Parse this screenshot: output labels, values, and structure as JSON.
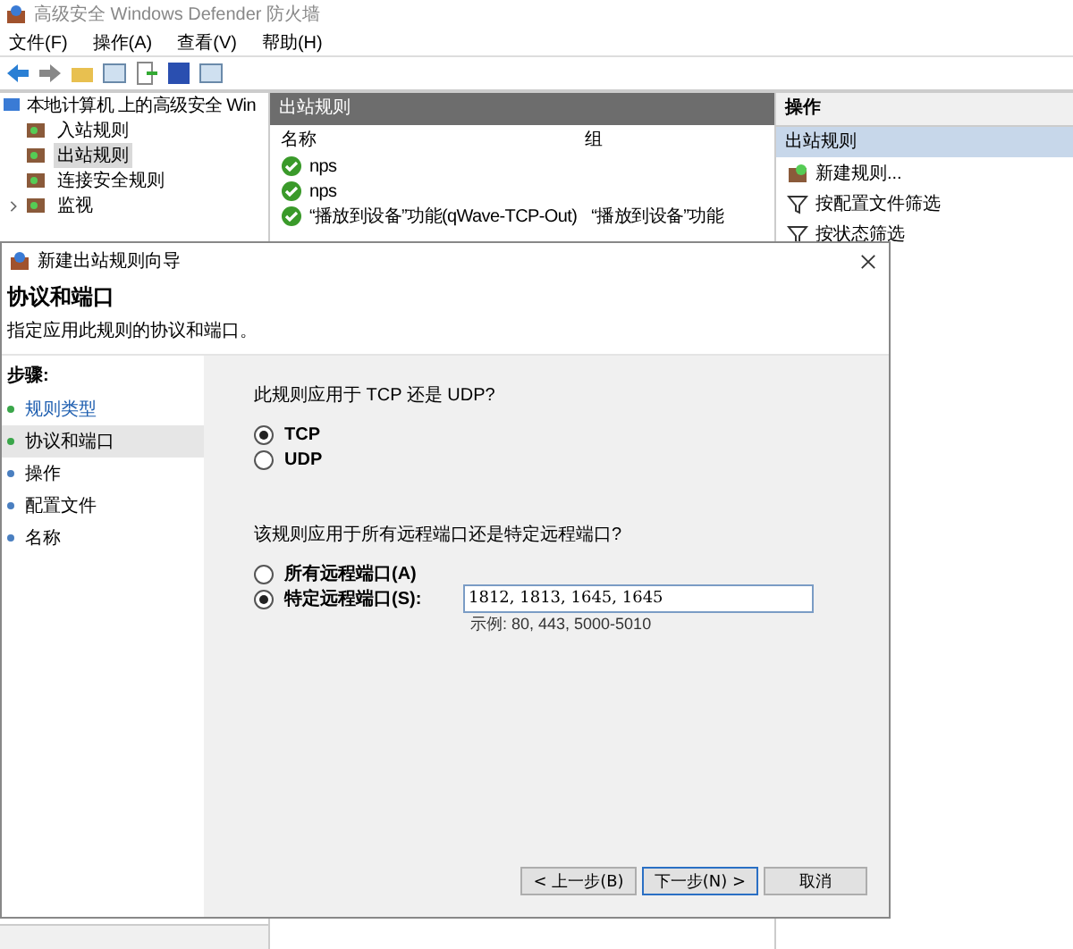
{
  "window": {
    "title": "高级安全 Windows Defender 防火墙"
  },
  "menu": [
    "文件(F)",
    "操作(A)",
    "查看(V)",
    "帮助(H)"
  ],
  "tree": {
    "label": "本地计算机 上的高级安全 Win",
    "children": [
      {
        "label": "入站规则",
        "selected": false
      },
      {
        "label": "出站规则",
        "selected": true
      },
      {
        "label": "连接安全规则",
        "selected": false
      },
      {
        "label": "监视",
        "selected": false,
        "expanded": false
      }
    ]
  },
  "rules": {
    "title": "出站规则",
    "columns": [
      "名称",
      "组"
    ],
    "rows": [
      {
        "name": "nps",
        "group": "",
        "enabled": true
      },
      {
        "name": "nps",
        "group": "",
        "enabled": true
      },
      {
        "name": "“播放到设备”功能(qWave-TCP-Out)",
        "group": "“播放到设备”功能",
        "enabled": true
      }
    ]
  },
  "actions": {
    "title": "操作",
    "section": "出站规则",
    "items": [
      {
        "label": "新建规则...",
        "kind": "new"
      },
      {
        "label": "按配置文件筛选",
        "kind": "filter"
      },
      {
        "label": "按状态筛选",
        "kind": "filter"
      }
    ]
  },
  "wizard": {
    "title": "新建出站规则向导",
    "heading": "协议和端口",
    "subtitle": "指定应用此规则的协议和端口。",
    "steps_title": "步骤:",
    "steps": [
      {
        "label": "规则类型",
        "done": true,
        "selected": false
      },
      {
        "label": "协议和端口",
        "done": true,
        "selected": true
      },
      {
        "label": "操作",
        "done": false,
        "selected": false
      },
      {
        "label": "配置文件",
        "done": false,
        "selected": false
      },
      {
        "label": "名称",
        "done": false,
        "selected": false
      }
    ],
    "protocol_question": "此规则应用于 TCP 还是 UDP?",
    "protocols": [
      {
        "label": "TCP",
        "selected": true
      },
      {
        "label": "UDP",
        "selected": false
      }
    ],
    "port_question": "该规则应用于所有远程端口还是特定远程端口?",
    "ports": [
      {
        "label": "所有远程端口(A)",
        "selected": false
      },
      {
        "label": "特定远程端口(S):",
        "selected": true
      }
    ],
    "port_value": "1812, 1813, 1645, 1645",
    "port_example": "示例: 80, 443, 5000-5010",
    "buttons": [
      {
        "label": "< 上一步(B)",
        "default": false
      },
      {
        "label": "下一步(N) >",
        "default": true
      },
      {
        "label": "取消",
        "default": false
      }
    ]
  }
}
